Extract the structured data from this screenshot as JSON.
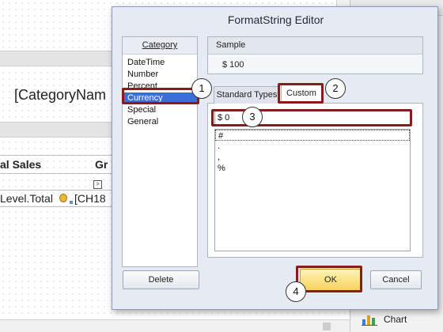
{
  "background": {
    "category_field": "[CategoryNam",
    "table_headers": [
      "al Sales",
      "Gr"
    ],
    "table_row": [
      "Level.Total",
      "[CH18"
    ],
    "smart_tag": ">",
    "close_glyph": "×",
    "panel_item_chart": "Chart"
  },
  "dialog": {
    "title": "FormatString Editor",
    "category_header": "Category",
    "categories": [
      "DateTime",
      "Number",
      "Percent",
      "Currency",
      "Special",
      "General"
    ],
    "selected_category": "Currency",
    "sample_header": "Sample",
    "sample_value": "$ 100",
    "tabs": [
      "Standard Types",
      "Custom"
    ],
    "active_tab": "Custom",
    "format_input_value": "$ 0",
    "format_list": [
      "#",
      ".",
      ",",
      "%"
    ],
    "buttons": {
      "delete": "Delete",
      "ok": "OK",
      "cancel": "Cancel"
    }
  },
  "callouts": [
    "1",
    "2",
    "3",
    "4"
  ],
  "colors": {
    "callout_border": "#8b1a1a",
    "selection": "#3a6fd8",
    "ok_button": "#f5d35a",
    "dialog_bg": "#e6ebf3"
  }
}
